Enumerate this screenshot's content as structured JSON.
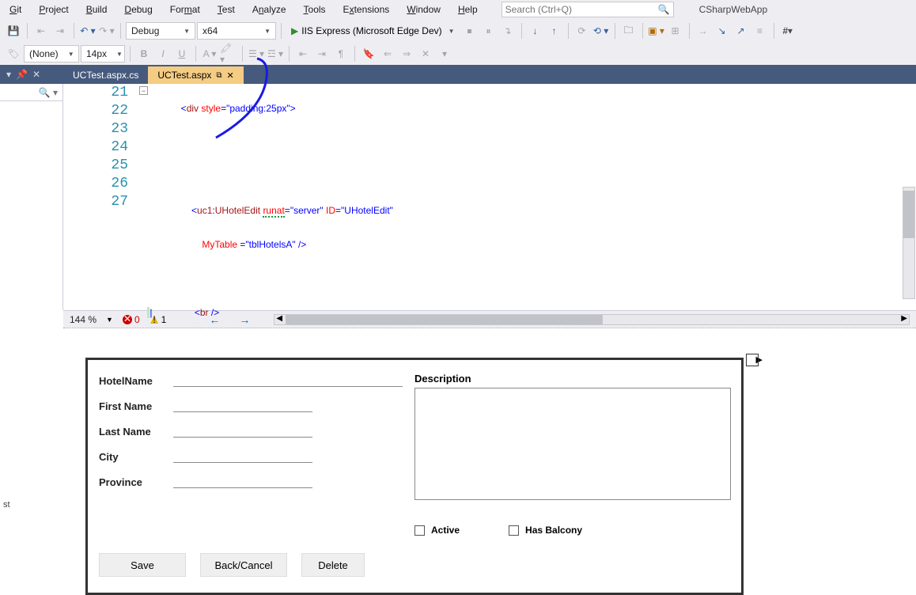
{
  "menu": [
    "Git",
    "Project",
    "Build",
    "Debug",
    "Format",
    "Test",
    "Analyze",
    "Tools",
    "Extensions",
    "Window",
    "Help"
  ],
  "menu_accel": [
    0,
    0,
    0,
    0,
    3,
    0,
    0,
    0,
    1,
    0,
    0
  ],
  "search": {
    "placeholder": "Search (Ctrl+Q)"
  },
  "project_name": "CSharpWebApp",
  "toolbar": {
    "config": "Debug",
    "platform": "x64",
    "run_label": "IIS Express (Microsoft Edge Dev)"
  },
  "toolbar2": {
    "tag_dropdown": "(None)",
    "size_dropdown": "14px"
  },
  "tabs": [
    {
      "label": "UCTest.aspx.cs",
      "active": false
    },
    {
      "label": "UCTest.aspx",
      "active": true
    }
  ],
  "editor": {
    "lines": [
      21,
      22,
      23,
      24,
      25,
      26,
      27
    ],
    "code": {
      "l21": {
        "pre": "           <",
        "tag": "div",
        "sp": " ",
        "attr": "style",
        "eq": "=",
        "val": "\"padding:25px\"",
        "end": ">"
      },
      "l24": {
        "pre": "               <",
        "ns": "uc1",
        "colon": ":",
        "tag": "UHotelEdit",
        "sp": " ",
        "attr1": "runat",
        "v1": "\"server\"",
        "attr2": "ID",
        "v2": "\"UHotelEdit\""
      },
      "l25": {
        "pre": "                   ",
        "attr": "MyTable",
        "sp": " ",
        "eq": "=",
        "val": "\"tblHotelsA\"",
        "end": " />"
      },
      "l27": {
        "pre": "                <",
        "tag": "br",
        "end": " />"
      }
    }
  },
  "status": {
    "zoom": "144 %",
    "errors": "0",
    "warnings": "1"
  },
  "form": {
    "fields": [
      "HotelName",
      "First Name",
      "Last Name",
      "City",
      "Province"
    ],
    "desc_label": "Description",
    "active_label": "Active",
    "balcony_label": "Has Balcony",
    "buttons": [
      "Save",
      "Back/Cancel",
      "Delete"
    ]
  },
  "frag": "st"
}
